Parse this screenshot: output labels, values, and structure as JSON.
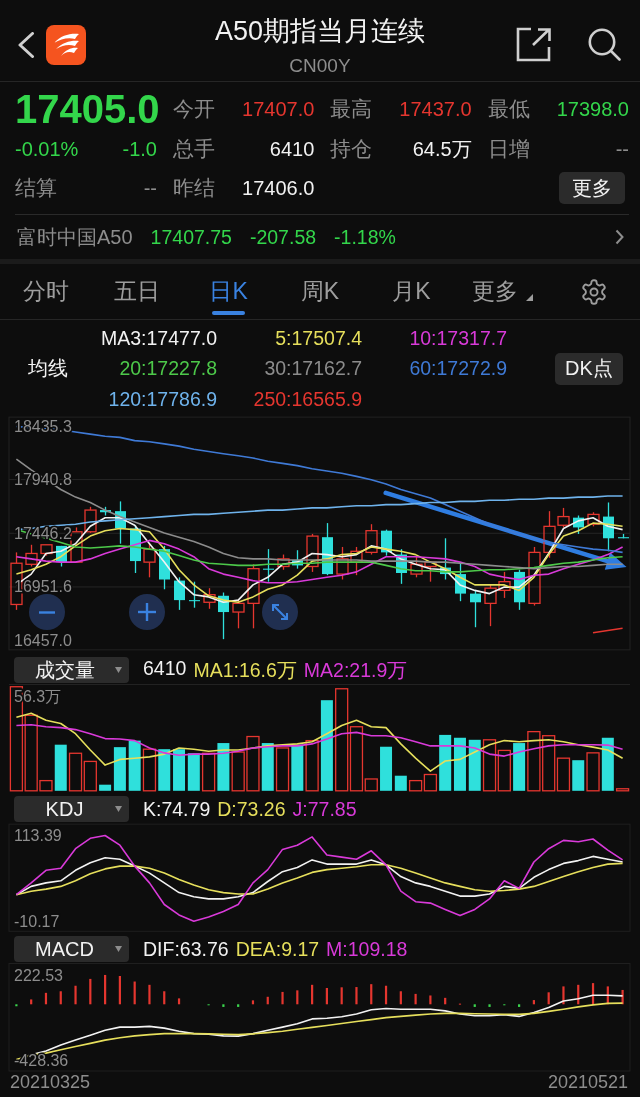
{
  "header": {
    "title": "A50期指当月连续",
    "code": "CN00Y"
  },
  "quote": {
    "price": {
      "text": "17405.0",
      "color": "#33d64b"
    },
    "change_percent": {
      "text": "-0.01%",
      "color": "#33d64b"
    },
    "change": {
      "text": "-1.0",
      "color": "#33d64b"
    },
    "stats": [
      {
        "label": "今开",
        "value": "17407.0",
        "color": "#e5362f"
      },
      {
        "label": "最高",
        "value": "17437.0",
        "color": "#e5362f"
      },
      {
        "label": "最低",
        "value": "17398.0",
        "color": "#33d64b"
      },
      {
        "label": "总手",
        "value": "6410",
        "color": "#f2f2f2"
      },
      {
        "label": "持仓",
        "value": "64.5万",
        "color": "#f2f2f2"
      },
      {
        "label": "日增",
        "value": "--",
        "color": "#8d8d8d"
      }
    ],
    "settlement": {
      "label": "结算",
      "value": "--"
    },
    "prev_settlement": {
      "label": "昨结",
      "value": "17406.0"
    },
    "more_button": "更多"
  },
  "index_quote": {
    "name": "富时中国A50",
    "values": [
      {
        "text": "17407.75",
        "color": "#33d64b"
      },
      {
        "text": "-207.58",
        "color": "#33d64b"
      },
      {
        "text": "-1.18%",
        "color": "#33d64b"
      }
    ]
  },
  "period_tabs": [
    {
      "label": "分时",
      "kind": "tab",
      "selected": false
    },
    {
      "label": "五日",
      "kind": "tab",
      "selected": false
    },
    {
      "label": "日K",
      "kind": "tab",
      "selected": true
    },
    {
      "label": "周K",
      "kind": "tab",
      "selected": false
    },
    {
      "label": "月K",
      "kind": "tab",
      "selected": false
    },
    {
      "label": "更多",
      "kind": "menu",
      "selected": false
    }
  ],
  "price_chart": {
    "legend_title": "均线",
    "dk_button": "DK点",
    "chart_data": {
      "type": "candlestick",
      "grid": true,
      "categories": [
        null,
        null,
        null,
        null,
        null,
        null,
        null,
        null,
        null,
        null,
        null,
        null,
        null,
        null,
        null,
        null,
        null,
        null,
        null,
        null,
        null,
        null,
        null,
        null,
        null,
        null,
        null,
        null,
        null,
        null,
        null,
        null,
        null,
        null,
        null,
        null,
        null,
        null,
        null,
        null,
        null,
        null
      ],
      "ylim": [
        16372,
        18517
      ],
      "yticks": [
        {
          "value": 18435.3,
          "label": "18435.3"
        },
        {
          "value": 17940.8,
          "label": "17940.8"
        },
        {
          "value": 17446.2,
          "label": "17446.2"
        },
        {
          "value": 16951.6,
          "label": "16951.6"
        },
        {
          "value": 16457.0,
          "label": "16457.0"
        }
      ],
      "ohlc": [
        [
          16790,
          17270,
          16740,
          17170
        ],
        [
          17160,
          17340,
          17140,
          17260
        ],
        [
          17260,
          17340,
          17240,
          17340
        ],
        [
          17330,
          17330,
          17140,
          17180
        ],
        [
          17180,
          17500,
          17180,
          17460
        ],
        [
          17460,
          17690,
          17450,
          17660
        ],
        [
          17660,
          17690,
          17610,
          17640
        ],
        [
          17650,
          17740,
          17350,
          17490
        ],
        [
          17490,
          17520,
          17080,
          17190
        ],
        [
          17180,
          17350,
          17040,
          17300
        ],
        [
          17300,
          17330,
          16930,
          17020
        ],
        [
          17010,
          17040,
          16740,
          16830
        ],
        [
          16830,
          17000,
          16760,
          16820
        ],
        [
          16810,
          16940,
          16750,
          16880
        ],
        [
          16870,
          16900,
          16470,
          16720
        ],
        [
          16720,
          16830,
          16570,
          16800
        ],
        [
          16800,
          17160,
          16570,
          17120
        ],
        [
          17120,
          17300,
          17000,
          17110
        ],
        [
          17140,
          17250,
          17110,
          17210
        ],
        [
          17200,
          17290,
          17120,
          17150
        ],
        [
          17140,
          17440,
          17090,
          17420
        ],
        [
          17410,
          17540,
          17060,
          17070
        ],
        [
          17070,
          17320,
          17020,
          17210
        ],
        [
          17180,
          17320,
          17060,
          17280
        ],
        [
          17270,
          17530,
          17250,
          17470
        ],
        [
          17470,
          17480,
          17240,
          17270
        ],
        [
          17250,
          17300,
          16980,
          17080
        ],
        [
          17070,
          17230,
          17040,
          17160
        ],
        [
          17140,
          17190,
          17000,
          17180
        ],
        [
          17130,
          17400,
          17020,
          17070
        ],
        [
          17070,
          17170,
          16820,
          16890
        ],
        [
          16890,
          16920,
          16580,
          16810
        ],
        [
          16800,
          16970,
          16590,
          16940
        ],
        [
          16920,
          17090,
          16850,
          17000
        ],
        [
          17090,
          17110,
          16740,
          16810
        ],
        [
          16800,
          17320,
          16780,
          17270
        ],
        [
          17270,
          17650,
          17220,
          17510
        ],
        [
          17520,
          17680,
          17500,
          17600
        ],
        [
          17590,
          17610,
          17440,
          17500
        ],
        [
          17530,
          17640,
          17510,
          17620
        ],
        [
          17600,
          17730,
          17280,
          17400
        ],
        [
          17410,
          17440,
          17400,
          17400
        ]
      ],
      "series": [
        {
          "name": "MA3:17477.0",
          "type": "line",
          "color": "#f2f2f2",
          "values": [
            16970,
            17070,
            17260,
            17280,
            17350,
            17510,
            17590,
            17590,
            17520,
            17350,
            17180,
            17000,
            16880,
            16860,
            16810,
            16830,
            16970,
            17040,
            17160,
            17180,
            17260,
            17250,
            17230,
            17250,
            17330,
            17300,
            17210,
            17160,
            17120,
            17110,
            16970,
            16920,
            16890,
            16950,
            16950,
            17060,
            17260,
            17490,
            17560,
            17590,
            17510,
            17480
          ]
        },
        {
          "name": "5:17507.4",
          "type": "line",
          "color": "#e6df5c",
          "values": [
            17070,
            17110,
            17160,
            17230,
            17330,
            17420,
            17470,
            17490,
            17480,
            17460,
            17300,
            17110,
            16970,
            16870,
            16830,
            16810,
            16860,
            16930,
            16970,
            17060,
            17190,
            17210,
            17250,
            17260,
            17320,
            17300,
            17280,
            17250,
            17180,
            17120,
            17040,
            16970,
            16970,
            16970,
            16920,
            17040,
            17250,
            17420,
            17470,
            17540,
            17530,
            17510
          ]
        },
        {
          "name": "10:17317.7",
          "type": "line",
          "color": "#d93ad9",
          "values": [
            17230,
            17210,
            17190,
            17180,
            17180,
            17210,
            17260,
            17300,
            17340,
            17380,
            17350,
            17300,
            17230,
            17120,
            17070,
            17040,
            17010,
            16990,
            16990,
            17000,
            17020,
            17040,
            17060,
            17090,
            17160,
            17230,
            17230,
            17230,
            17220,
            17210,
            17180,
            17140,
            17070,
            17040,
            17020,
            17060,
            17070,
            17120,
            17160,
            17200,
            17250,
            17320
          ]
        },
        {
          "name": "20:17227.8",
          "type": "line",
          "color": "#4dc94a",
          "values": [
            17480,
            17440,
            17400,
            17360,
            17320,
            17310,
            17320,
            17330,
            17320,
            17300,
            17280,
            17240,
            17200,
            17170,
            17160,
            17150,
            17150,
            17160,
            17160,
            17170,
            17170,
            17180,
            17180,
            17180,
            17180,
            17150,
            17120,
            17100,
            17100,
            17090,
            17090,
            17100,
            17110,
            17110,
            17120,
            17130,
            17150,
            17170,
            17180,
            17200,
            17220,
            17230
          ]
        },
        {
          "name": "30:17162.7",
          "type": "line",
          "color": "#8c8c8c",
          "values": [
            18130,
            18030,
            17940,
            17850,
            17780,
            17730,
            17660,
            17600,
            17550,
            17500,
            17450,
            17410,
            17370,
            17320,
            17260,
            17220,
            17210,
            17210,
            17200,
            17200,
            17200,
            17200,
            17200,
            17200,
            17190,
            17190,
            17190,
            17190,
            17180,
            17180,
            17170,
            17160,
            17150,
            17140,
            17130,
            17120,
            17130,
            17140,
            17140,
            17150,
            17160,
            17160
          ]
        },
        {
          "name": "60:17272.9",
          "type": "line",
          "color": "#3f7ad6",
          "values": [
            18430,
            18420,
            18410,
            18400,
            18380,
            18360,
            18340,
            18330,
            18300,
            18290,
            18270,
            18250,
            18220,
            18200,
            18180,
            18160,
            18140,
            18110,
            18090,
            18070,
            18040,
            18020,
            18000,
            17970,
            17940,
            17900,
            17850,
            17810,
            17770,
            17710,
            17650,
            17590,
            17530,
            17480,
            17440,
            17400,
            17360,
            17340,
            17320,
            17300,
            17290,
            17270
          ]
        },
        {
          "name": "120:17786.9",
          "type": "line",
          "color": "#6fb3ec",
          "values": [
            17480,
            17490,
            17510,
            17520,
            17530,
            17550,
            17560,
            17570,
            17580,
            17590,
            17600,
            17610,
            17620,
            17620,
            17630,
            17640,
            17650,
            17660,
            17660,
            17670,
            17680,
            17680,
            17690,
            17700,
            17700,
            17710,
            17710,
            17720,
            17730,
            17730,
            17740,
            17740,
            17750,
            17750,
            17760,
            17760,
            17770,
            17770,
            17780,
            17780,
            17790,
            17790
          ]
        },
        {
          "name": "250:16565.9",
          "type": "line",
          "color": "#e5362f",
          "values": [
            null,
            null,
            null,
            null,
            null,
            null,
            null,
            null,
            null,
            null,
            null,
            null,
            null,
            null,
            null,
            null,
            null,
            null,
            null,
            null,
            null,
            null,
            null,
            null,
            null,
            null,
            null,
            null,
            null,
            null,
            null,
            null,
            null,
            null,
            null,
            null,
            null,
            null,
            null,
            16530,
            16550,
            16570
          ]
        }
      ]
    }
  },
  "volume": {
    "selector": "成交量",
    "legend": [
      {
        "text": "6410",
        "color": "#f2f2f2"
      },
      {
        "text": "MA1:16.6万",
        "color": "#e6df5c"
      },
      {
        "text": "MA2:21.9万",
        "color": "#d93ad9"
      }
    ],
    "max_label": "56.3万"
  },
  "kdj": {
    "selector": "KDJ",
    "chart_data": {
      "type": "line",
      "ylim": [
        -24.5,
        129.2
      ],
      "yticks": [
        113.39,
        -10.17
      ],
      "series": [
        {
          "name": "K:74.79",
          "color": "#f2f2f2",
          "values": [
            28,
            40,
            45,
            48,
            63,
            74,
            81,
            79,
            69,
            59,
            45,
            31,
            25,
            22,
            22,
            25,
            31,
            47,
            61,
            67,
            78,
            72,
            72,
            72,
            78,
            71,
            54,
            45,
            40,
            33,
            26,
            26,
            29,
            40,
            37,
            53,
            64,
            73,
            77,
            83,
            79,
            75
          ]
        },
        {
          "name": "D:73.26",
          "color": "#e6df5c",
          "values": [
            28,
            33,
            36,
            40,
            48,
            58,
            65,
            69,
            69,
            66,
            59,
            50,
            42,
            35,
            31,
            29,
            29,
            36,
            45,
            52,
            60,
            64,
            66,
            68,
            71,
            71,
            66,
            59,
            52,
            45,
            40,
            35,
            33,
            34,
            36,
            40,
            47,
            54,
            61,
            67,
            72,
            73
          ]
        },
        {
          "name": "J:77.85",
          "color": "#d93ad9",
          "values": [
            28,
            45,
            63,
            66,
            94,
            109,
            113,
            99,
            69,
            45,
            14,
            -1,
            -10,
            -4,
            4,
            14,
            45,
            64,
            93,
            99,
            111,
            85,
            82,
            79,
            91,
            71,
            33,
            18,
            16,
            7,
            -2,
            7,
            22,
            48,
            37,
            75,
            94,
            106,
            104,
            108,
            92,
            78
          ]
        }
      ]
    }
  },
  "macd": {
    "selector": "MACD",
    "chart_data": {
      "type": "line",
      "ylim": [
        -507,
        310
      ],
      "yticks": [
        222.53,
        -428.36
      ],
      "series": [
        {
          "name": "DIF:63.76",
          "color": "#f2f2f2",
          "values": [
            -428,
            -383,
            -354,
            -309,
            -272,
            -235,
            -198,
            -173,
            -173,
            -168,
            -181,
            -205,
            -223,
            -228,
            -240,
            -242,
            -223,
            -198,
            -173,
            -148,
            -111,
            -106,
            -94,
            -74,
            -42,
            -32,
            -37,
            -37,
            -37,
            -50,
            -74,
            -87,
            -87,
            -79,
            -92,
            -62,
            -25,
            25,
            42,
            69,
            69,
            64
          ]
        },
        {
          "name": "DEA:9.17",
          "color": "#e6df5c",
          "values": [
            -420,
            -388,
            -371,
            -346,
            -321,
            -297,
            -272,
            -255,
            -240,
            -230,
            -223,
            -223,
            -223,
            -225,
            -228,
            -230,
            -225,
            -215,
            -205,
            -190,
            -176,
            -161,
            -146,
            -131,
            -116,
            -101,
            -92,
            -82,
            -74,
            -69,
            -69,
            -72,
            -74,
            -77,
            -77,
            -69,
            -54,
            -37,
            -20,
            -5,
            7,
            9
          ]
        },
        {
          "type": "bar",
          "color": "#e5362f",
          "values": [
            null,
            37,
            87,
            99,
            141,
            193,
            223,
            215,
            173,
            148,
            99,
            45,
            null,
            null,
            null,
            null,
            30,
            57,
            94,
            106,
            148,
            124,
            129,
            131,
            153,
            141,
            99,
            79,
            67,
            49,
            5,
            null,
            null,
            null,
            null,
            32,
            91,
            136,
            148,
            161,
            136,
            109
          ]
        },
        {
          "type": "bar",
          "color": "#3bd44d",
          "values": [
            -15,
            null,
            null,
            null,
            null,
            null,
            null,
            null,
            null,
            null,
            null,
            null,
            null,
            -5,
            -20,
            -20,
            null,
            null,
            null,
            null,
            null,
            null,
            null,
            null,
            null,
            null,
            null,
            null,
            null,
            null,
            null,
            -20,
            -20,
            -3,
            -20,
            null,
            null,
            null,
            null,
            null,
            null,
            null
          ]
        }
      ]
    },
    "histogram_label": {
      "text": "M:109.18",
      "color": "#d93ad9"
    }
  },
  "date_range": {
    "start": "20210325",
    "end": "20210521"
  }
}
